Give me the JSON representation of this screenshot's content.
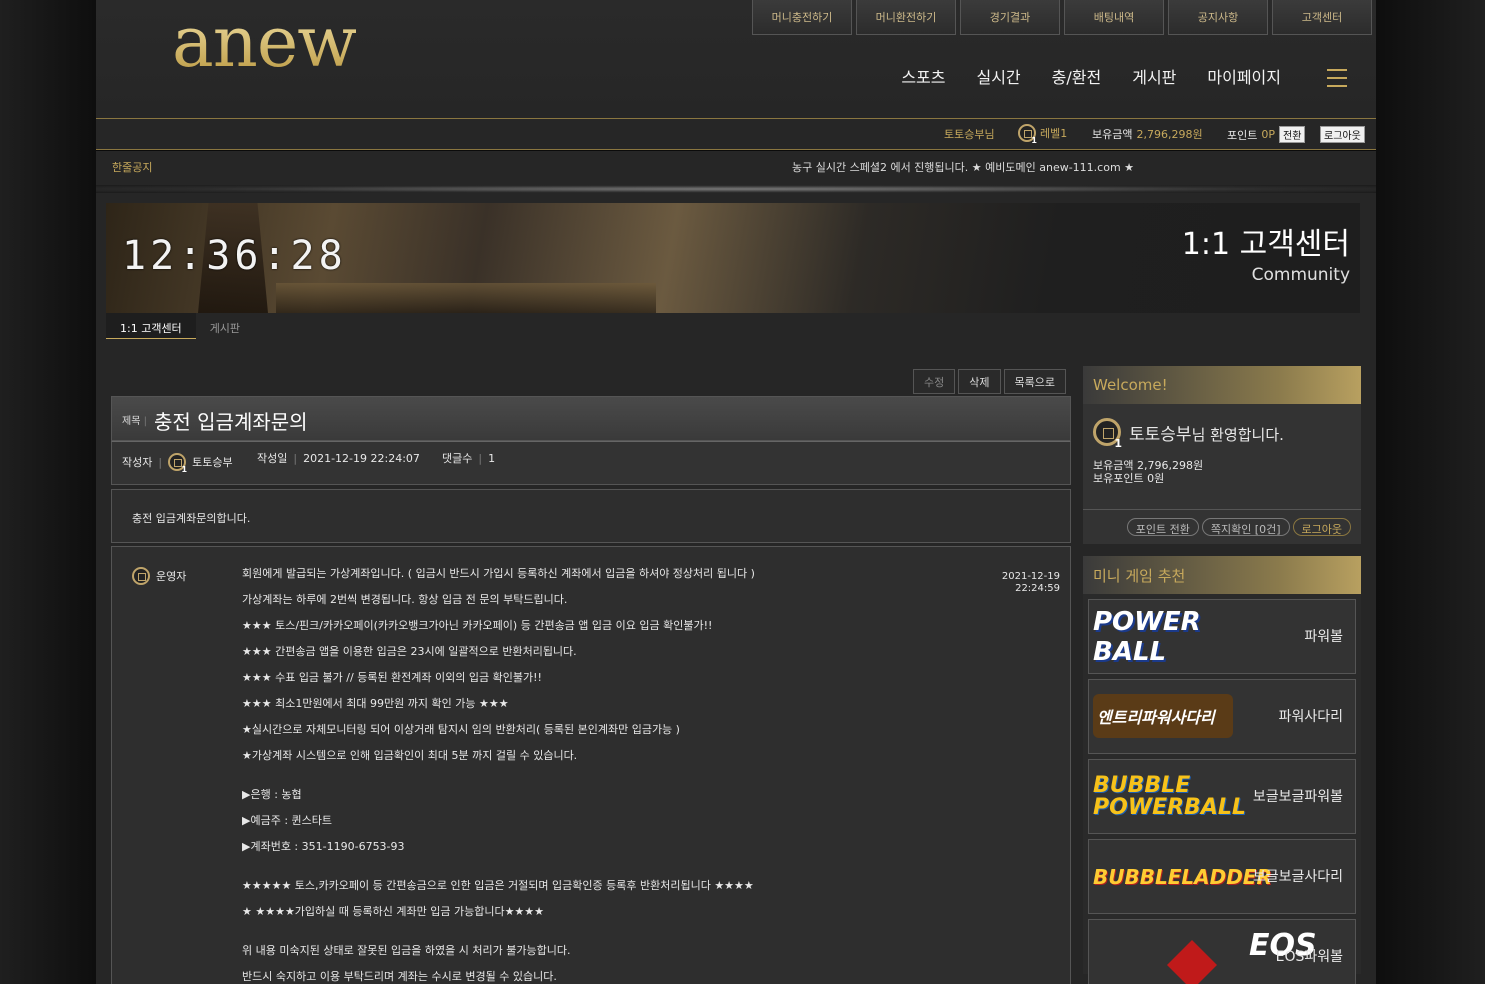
{
  "logo": "anew",
  "top_buttons": [
    "머니충전하기",
    "머니환전하기",
    "경기결과",
    "배팅내역",
    "공지사항",
    "고객센터"
  ],
  "main_nav": [
    "스포츠",
    "실시간",
    "충/환전",
    "게시판",
    "마이페이지"
  ],
  "userbar": {
    "username": "토토승부님",
    "level": "레벨1",
    "balance_label": "보유금액",
    "balance": "2,796,298원",
    "point_label": "포인트",
    "point": "0P",
    "convert": "전환",
    "logout": "로그아웃"
  },
  "notice": {
    "label": "한줄공지",
    "text": "농구 실시간 스페셜2 에서 진행됩니다. ★ 예비도메인 anew-111.com ★"
  },
  "banner": {
    "clock": "12:36:28",
    "title": "1:1 고객센터",
    "subtitle": "Community"
  },
  "tabs": [
    "1:1 고객센터",
    "게시판"
  ],
  "actions": [
    "수정",
    "삭제",
    "목록으로"
  ],
  "post": {
    "title_label": "제목",
    "title": "충전 입금계좌문의",
    "author_label": "작성자",
    "author": "토토승부",
    "date_label": "작성일",
    "date": "2021-12-19 22:24:07",
    "comments_label": "댓글수",
    "comments": "1",
    "body": "충전 입금계좌문의합니다."
  },
  "comment": {
    "author": "운영자",
    "date": "2021-12-19",
    "time": "22:24:59",
    "lines": [
      "회원에게 발급되는 가상계좌입니다. ( 입금시 반드시 가입시 등록하신 계좌에서 입금을 하셔야 정상처리 됩니다 )",
      "가상계좌는 하루에 2번씩 변경됩니다. 항상 입금 전 문의 부탁드립니다.",
      "★★★ 토스/핀크/카카오페이(카카오뱅크가아닌 카카오페이) 등 간편송금 앱 입금 이요 입금 확인불가!!",
      "★★★ 간편송금 앱을 이용한 입금은 23시에 일괄적으로 반환처리됩니다.",
      "★★★ 수표 입금 불가 // 등록된 환전계좌 이외의 입금 확인불가!!",
      "★★★ 최소1만원에서 최대 99만원 까지 확인 가능 ★★★",
      "★실시간으로 자체모니터링 되어 이상거래 탐지시 임의 반환처리( 등록된 본인계좌만 입금가능 )",
      "★가상계좌 시스템으로 인해 입금확인이 최대 5분 까지 걸릴 수 있습니다."
    ],
    "bank_lines": [
      "▶은행 : 농협",
      "▶예금주 : 퀸스타트",
      "▶계좌번호 : 351-1190-6753-93"
    ],
    "warn_lines": [
      "★★★★★ 토스,카카오페이 등 간편송금으로 인한 입금은 거절되며 입금확인증 등록후 반환처리됩니다 ★★★★",
      "★ ★★★★가입하실 때 등록하신 계좌만 입금 가능합니다★★★★"
    ],
    "final_lines": [
      "위 내용 미숙지된 상태로 잘못된 입금을 하였을 시 처리가 불가능합니다.",
      "반드시 숙지하고 이용 부탁드리며 계좌는 수시로 변경될 수 있습니다."
    ]
  },
  "sidebar": {
    "welcome_title": "Welcome!",
    "welcome_user": "토토승부",
    "welcome_suffix": "님 환영합니다.",
    "balance_line": "보유금액 2,796,298원",
    "point_line": "보유포인트 0원",
    "buttons": [
      "포인트 전환",
      "쪽지확인 [0건]",
      "로그아웃"
    ],
    "mini_title": "미니 게임 추천",
    "games": [
      {
        "logo": "POWER BALL",
        "name": "파워볼"
      },
      {
        "logo": "엔트리파워사다리",
        "name": "파워사다리"
      },
      {
        "logo": "BUBBLE POWERBALL",
        "name": "보글보글파워볼"
      },
      {
        "logo": "BUBBLELADDER",
        "name": "보글보글사다리"
      },
      {
        "logo": "EOS",
        "name": "EOS파워볼"
      }
    ]
  }
}
